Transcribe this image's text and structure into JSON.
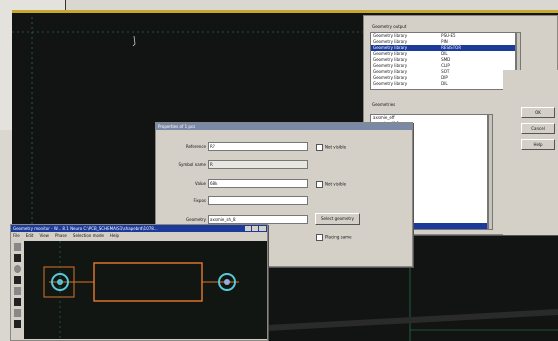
{
  "geometry_panel": {
    "title": "Geometry output",
    "rows": [
      {
        "lib": "Geometry library",
        "name": "PSU-E5"
      },
      {
        "lib": "Geometry library",
        "name": "PIN"
      },
      {
        "lib": "Geometry library",
        "name": "RESISTOR"
      },
      {
        "lib": "Geometry library",
        "name": "DIL"
      },
      {
        "lib": "Geometry library",
        "name": "SMD"
      },
      {
        "lib": "Geometry library",
        "name": "CLIP"
      },
      {
        "lib": "Geometry library",
        "name": "SOT"
      },
      {
        "lib": "Geometry library",
        "name": "DIP"
      },
      {
        "lib": "Geometry library",
        "name": "DIL"
      }
    ],
    "selected_index": 2,
    "geometries_label": "Geometries",
    "geometries": [
      "axsmie_eff",
      "axsmie_eff_1",
      "axsmie_sff_1",
      "axsmie_sff_2",
      "axsmie_sff",
      "axsmie_sh1",
      "axsmie_sh2",
      "axsmie_sh3",
      "axsmie_sh4",
      "axsmie_sh5",
      "axsmie_sh6",
      "axsmie_sh8",
      "axsmie_sh9s",
      "axsmie_sh8",
      "axsmie_sh8",
      "axsmie_sh_1",
      "axsmie_sh_1",
      "axsmie_sh_fa",
      "axsmie_sh_7",
      "axsmie_sh_7"
    ],
    "geometries_selected_index": 19,
    "ok_label": "OK",
    "cancel_label": "Cancel",
    "help_label": "Help"
  },
  "props_dialog": {
    "title": "Properties of 1 pcs",
    "reference_label": "Reference",
    "reference_value": "R?",
    "symbol_name_label": "Symbol name",
    "symbol_name_value": "R",
    "value_label": "Value",
    "value_value": "68k",
    "footprint_label": "Fixpos",
    "footprint_value": "",
    "geometry_label": "Geometry",
    "geometry_value": "axsmie_sh_8",
    "not_visible_1": "Not visible",
    "not_visible_2": "Not visible",
    "select_geometry_label": "Select geometry",
    "placing_label": "Placing same"
  },
  "geo_editor": {
    "title": "Geometry monitor - W... 8.1 Neuro C:\\PCB_SCHEMA\\S1\\shapebrd\\1078...",
    "menu": [
      "File",
      "Edit",
      "View",
      "Phase",
      "Selection mode",
      "Help"
    ]
  },
  "colors": {
    "desktop": "#d9d7d0",
    "canvas": "#111412",
    "selection": "#1b3a9a",
    "component_outline": "#d8742a",
    "pad": "#58c8d8"
  }
}
